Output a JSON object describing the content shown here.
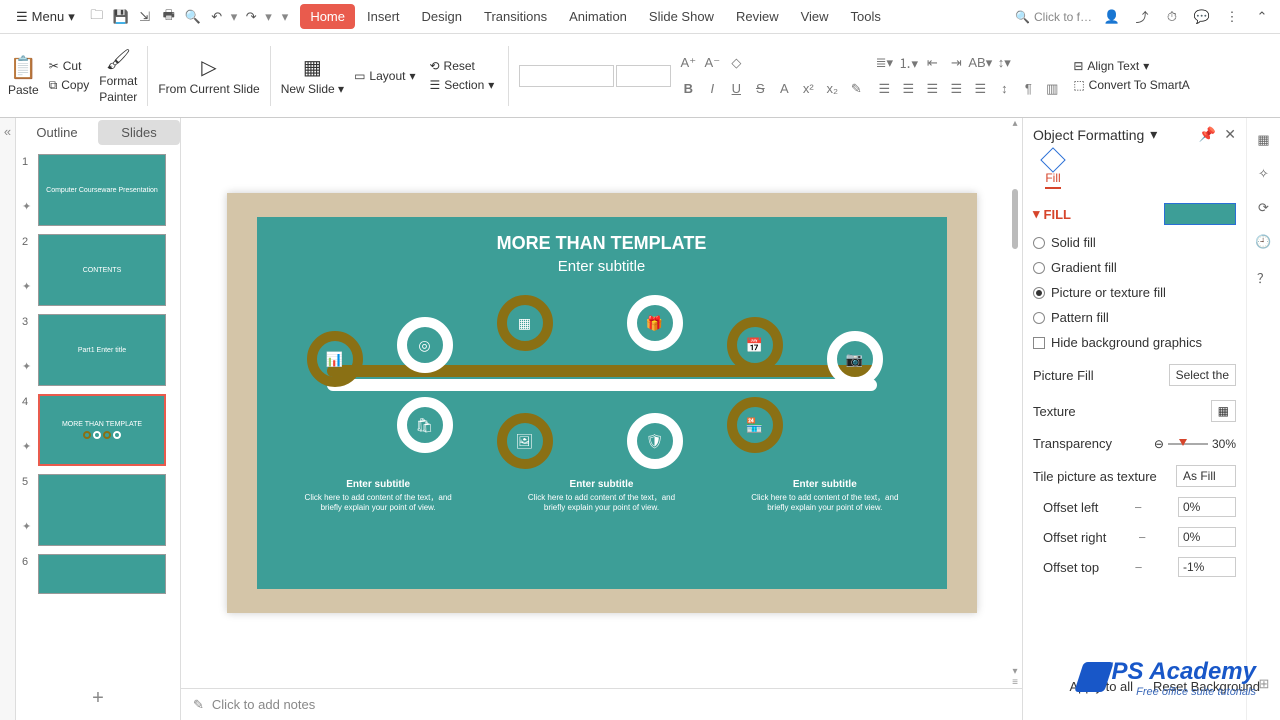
{
  "menubar": {
    "menu_label": "Menu",
    "search_placeholder": "Click to f…"
  },
  "tabs": [
    "Home",
    "Insert",
    "Design",
    "Transitions",
    "Animation",
    "Slide Show",
    "Review",
    "View",
    "Tools"
  ],
  "ribbon": {
    "paste": "Paste",
    "cut": "Cut",
    "copy": "Copy",
    "format_painter_l1": "Format",
    "format_painter_l2": "Painter",
    "from_current": "From Current Slide",
    "new_slide": "New Slide",
    "layout": "Layout",
    "reset": "Reset",
    "section": "Section",
    "align_text": "Align Text",
    "convert_smartart": "Convert To SmartA"
  },
  "panel_tabs": {
    "outline": "Outline",
    "slides": "Slides"
  },
  "thumbs": [
    {
      "num": "1",
      "title": "Computer Courseware Presentation"
    },
    {
      "num": "2",
      "title": "CONTENTS"
    },
    {
      "num": "3",
      "title": "Part1 Enter title"
    },
    {
      "num": "4",
      "title": "MORE THAN TEMPLATE"
    },
    {
      "num": "5",
      "title": ""
    },
    {
      "num": "6",
      "title": ""
    }
  ],
  "slide": {
    "title": "MORE THAN TEMPLATE",
    "subtitle": "Enter subtitle",
    "subtexts": [
      {
        "title": "Enter subtitle",
        "body": "Click here to add content of the text，and briefly explain your point of view."
      },
      {
        "title": "Enter subtitle",
        "body": "Click here to add content of the text，and briefly explain your point of view."
      },
      {
        "title": "Enter subtitle",
        "body": "Click here to add content of the text，and briefly explain your point of view."
      }
    ]
  },
  "notes_placeholder": "Click to add notes",
  "format_panel": {
    "title": "Object Formatting",
    "fill_label": "Fill",
    "section_title": "FILL",
    "opts": {
      "solid": "Solid fill",
      "gradient": "Gradient fill",
      "picture": "Picture or texture fill",
      "pattern": "Pattern fill",
      "hide_bg": "Hide background graphics"
    },
    "picture_fill": "Picture Fill",
    "picture_fill_value": "Select the",
    "texture": "Texture",
    "transparency": "Transparency",
    "transparency_value": "30%",
    "tile": "Tile picture as texture",
    "tile_value": "As Fill",
    "offset_left": "Offset left",
    "offset_left_value": "0%",
    "offset_right": "Offset right",
    "offset_right_value": "0%",
    "offset_top": "Offset top",
    "offset_top_value": "-1%",
    "apply_all": "Apply to all",
    "reset_bg": "Reset Background"
  },
  "watermark": {
    "main": "WPS Academy",
    "sub": "Free office suite tutorials"
  }
}
